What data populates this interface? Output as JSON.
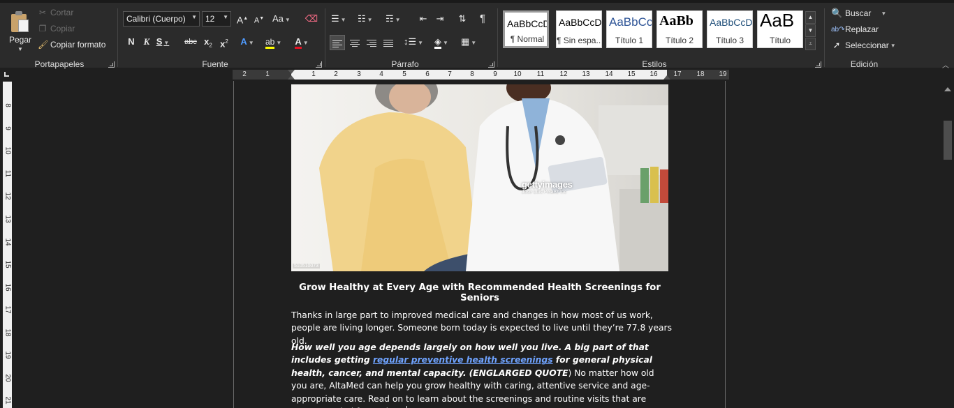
{
  "ribbon": {
    "clipboard": {
      "group_label": "Portapapeles",
      "paste_label": "Pegar",
      "cut_label": "Cortar",
      "copy_label": "Copiar",
      "format_painter_label": "Copiar formato"
    },
    "font": {
      "group_label": "Fuente",
      "font_name": "Calibri (Cuerpo)",
      "font_size": "12",
      "grow_label": "A",
      "shrink_label": "A",
      "case_label": "Aa",
      "bold_label": "N",
      "italic_label": "K",
      "underline_label": "S",
      "strike_label": "abc",
      "subscript_label": "x",
      "superscript_label": "x",
      "font_color": "#e81123",
      "highlight_color": "#ffff00"
    },
    "paragraph": {
      "group_label": "Párrafo",
      "pilcrow_label": "¶"
    },
    "styles": {
      "group_label": "Estilos",
      "items": [
        {
          "sample": "AaBbCcD",
          "name": "¶ Normal"
        },
        {
          "sample": "AaBbCcD",
          "name": "¶ Sin espa..."
        },
        {
          "sample": "AaBbCc",
          "name": "Título 1"
        },
        {
          "sample": "AaBb",
          "name": "Título 2"
        },
        {
          "sample": "AaBbCcD",
          "name": "Título 3"
        },
        {
          "sample": "AaB",
          "name": "Título"
        }
      ]
    },
    "editing": {
      "group_label": "Edición",
      "find_label": "Buscar",
      "replace_label": "Replazar",
      "select_label": "Seleccionar"
    }
  },
  "ruler": {
    "h_numbers_left": [
      "2",
      "1"
    ],
    "h_numbers_right": [
      "1",
      "2",
      "3",
      "4",
      "5",
      "6",
      "7",
      "8",
      "9",
      "10",
      "11",
      "12",
      "13",
      "14",
      "15",
      "16",
      "17",
      "18",
      "19"
    ],
    "v_numbers": [
      "8",
      "9",
      "10",
      "11",
      "12",
      "13",
      "14",
      "15",
      "16",
      "17",
      "18",
      "19",
      "20",
      "21"
    ]
  },
  "document": {
    "image": {
      "watermark_brand": "gettyimages",
      "watermark_credit": "Jose Luis Pelaez Inc",
      "image_id": "510510073"
    },
    "title": "Grow Healthy at Every Age with Recommended Health Screenings for Seniors",
    "para1": "Thanks in large part to improved medical care and changes in how most of us work, people are living longer. Someone born today is expected to live until they’re 77.8 years old.",
    "para2": {
      "bold_italic_start": "How well you age depends largely on how well you live. A big part of that includes getting ",
      "link_text": "regular preventive health screenings",
      "bold_italic_end": " for general physical health, cancer, and mental capacity.",
      "note": "(ENGLARGED QUOTE",
      "rest": ") No matter how old you are, AltaMed can help you grow healthy with caring, attentive service and age-appropriate care. Read on to learn about the screenings and routine visits that are recommended for seniors."
    }
  }
}
